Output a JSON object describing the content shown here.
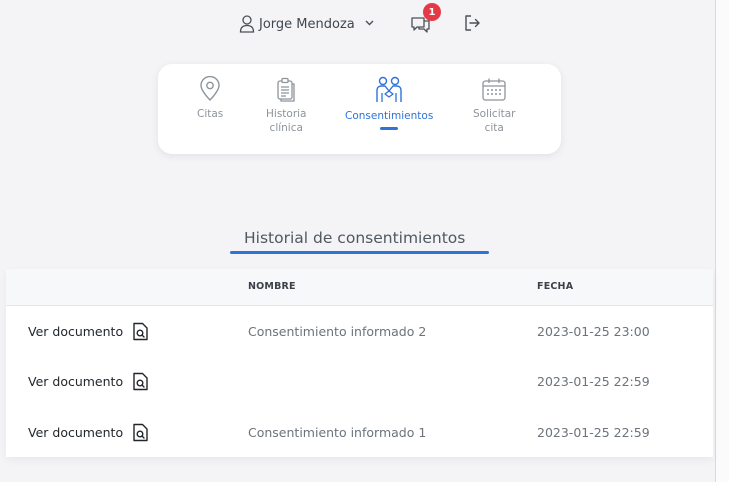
{
  "header": {
    "user_name": "Jorge Mendoza",
    "notification_count": "1",
    "icons": [
      "user-icon",
      "chevron-down-icon",
      "chat-icon",
      "logout-icon"
    ]
  },
  "nav": {
    "items": [
      {
        "label_line1": "Citas",
        "label_line2": "",
        "icon": "location-pin-icon",
        "active": false
      },
      {
        "label_line1": "Historia",
        "label_line2": "clínica",
        "icon": "clipboard-icon",
        "active": false
      },
      {
        "label_line1": "Consentimientos",
        "label_line2": "",
        "icon": "people-handshake-icon",
        "active": true
      },
      {
        "label_line1": "Solicitar",
        "label_line2": "cita",
        "icon": "calendar-icon",
        "active": false
      }
    ]
  },
  "section": {
    "title": "Historial de consentimientos"
  },
  "table": {
    "columns": [
      "",
      "NOMBRE",
      "FECHA"
    ],
    "rows": [
      {
        "action": "Ver documento",
        "nombre": "Consentimiento informado 2",
        "fecha": "2023-01-25 23:00"
      },
      {
        "action": "Ver documento",
        "nombre": "",
        "fecha": "2023-01-25 22:59"
      },
      {
        "action": "Ver documento",
        "nombre": "Consentimiento informado 1",
        "fecha": "2023-01-25 22:59"
      }
    ]
  },
  "colors": {
    "accent": "#2f72d8",
    "badge": "#e53946",
    "background": "#f4f4f6"
  }
}
